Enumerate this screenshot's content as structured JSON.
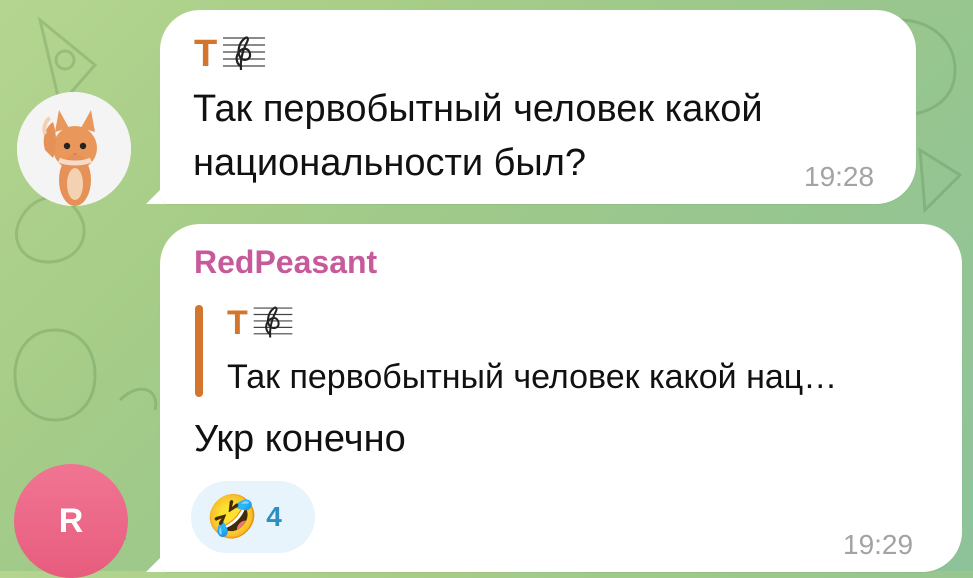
{
  "messages": [
    {
      "sender_initial": "T",
      "text": "Так первобытный человек какой\nнациональности был?",
      "time": "19:28"
    },
    {
      "sender_name": "RedPeasant",
      "reply": {
        "sender_initial": "T",
        "text": "Так первобытный человек какой нац…"
      },
      "text": "Укр конечно",
      "reaction": {
        "emoji_name": "rolling-on-the-floor-laughing",
        "emoji": "🤣",
        "count": "4"
      },
      "time": "19:29",
      "avatar_initial": "R"
    }
  ],
  "colors": {
    "accent_orange": "#d4752d",
    "sender_pink": "#c75a9a",
    "reaction_blue": "#2b8ec4",
    "avatar_pink": "#e85c7e"
  },
  "icons": {
    "music-staff": "treble-clef-staff-icon",
    "cat-avatar": "cat-photo-avatar"
  }
}
